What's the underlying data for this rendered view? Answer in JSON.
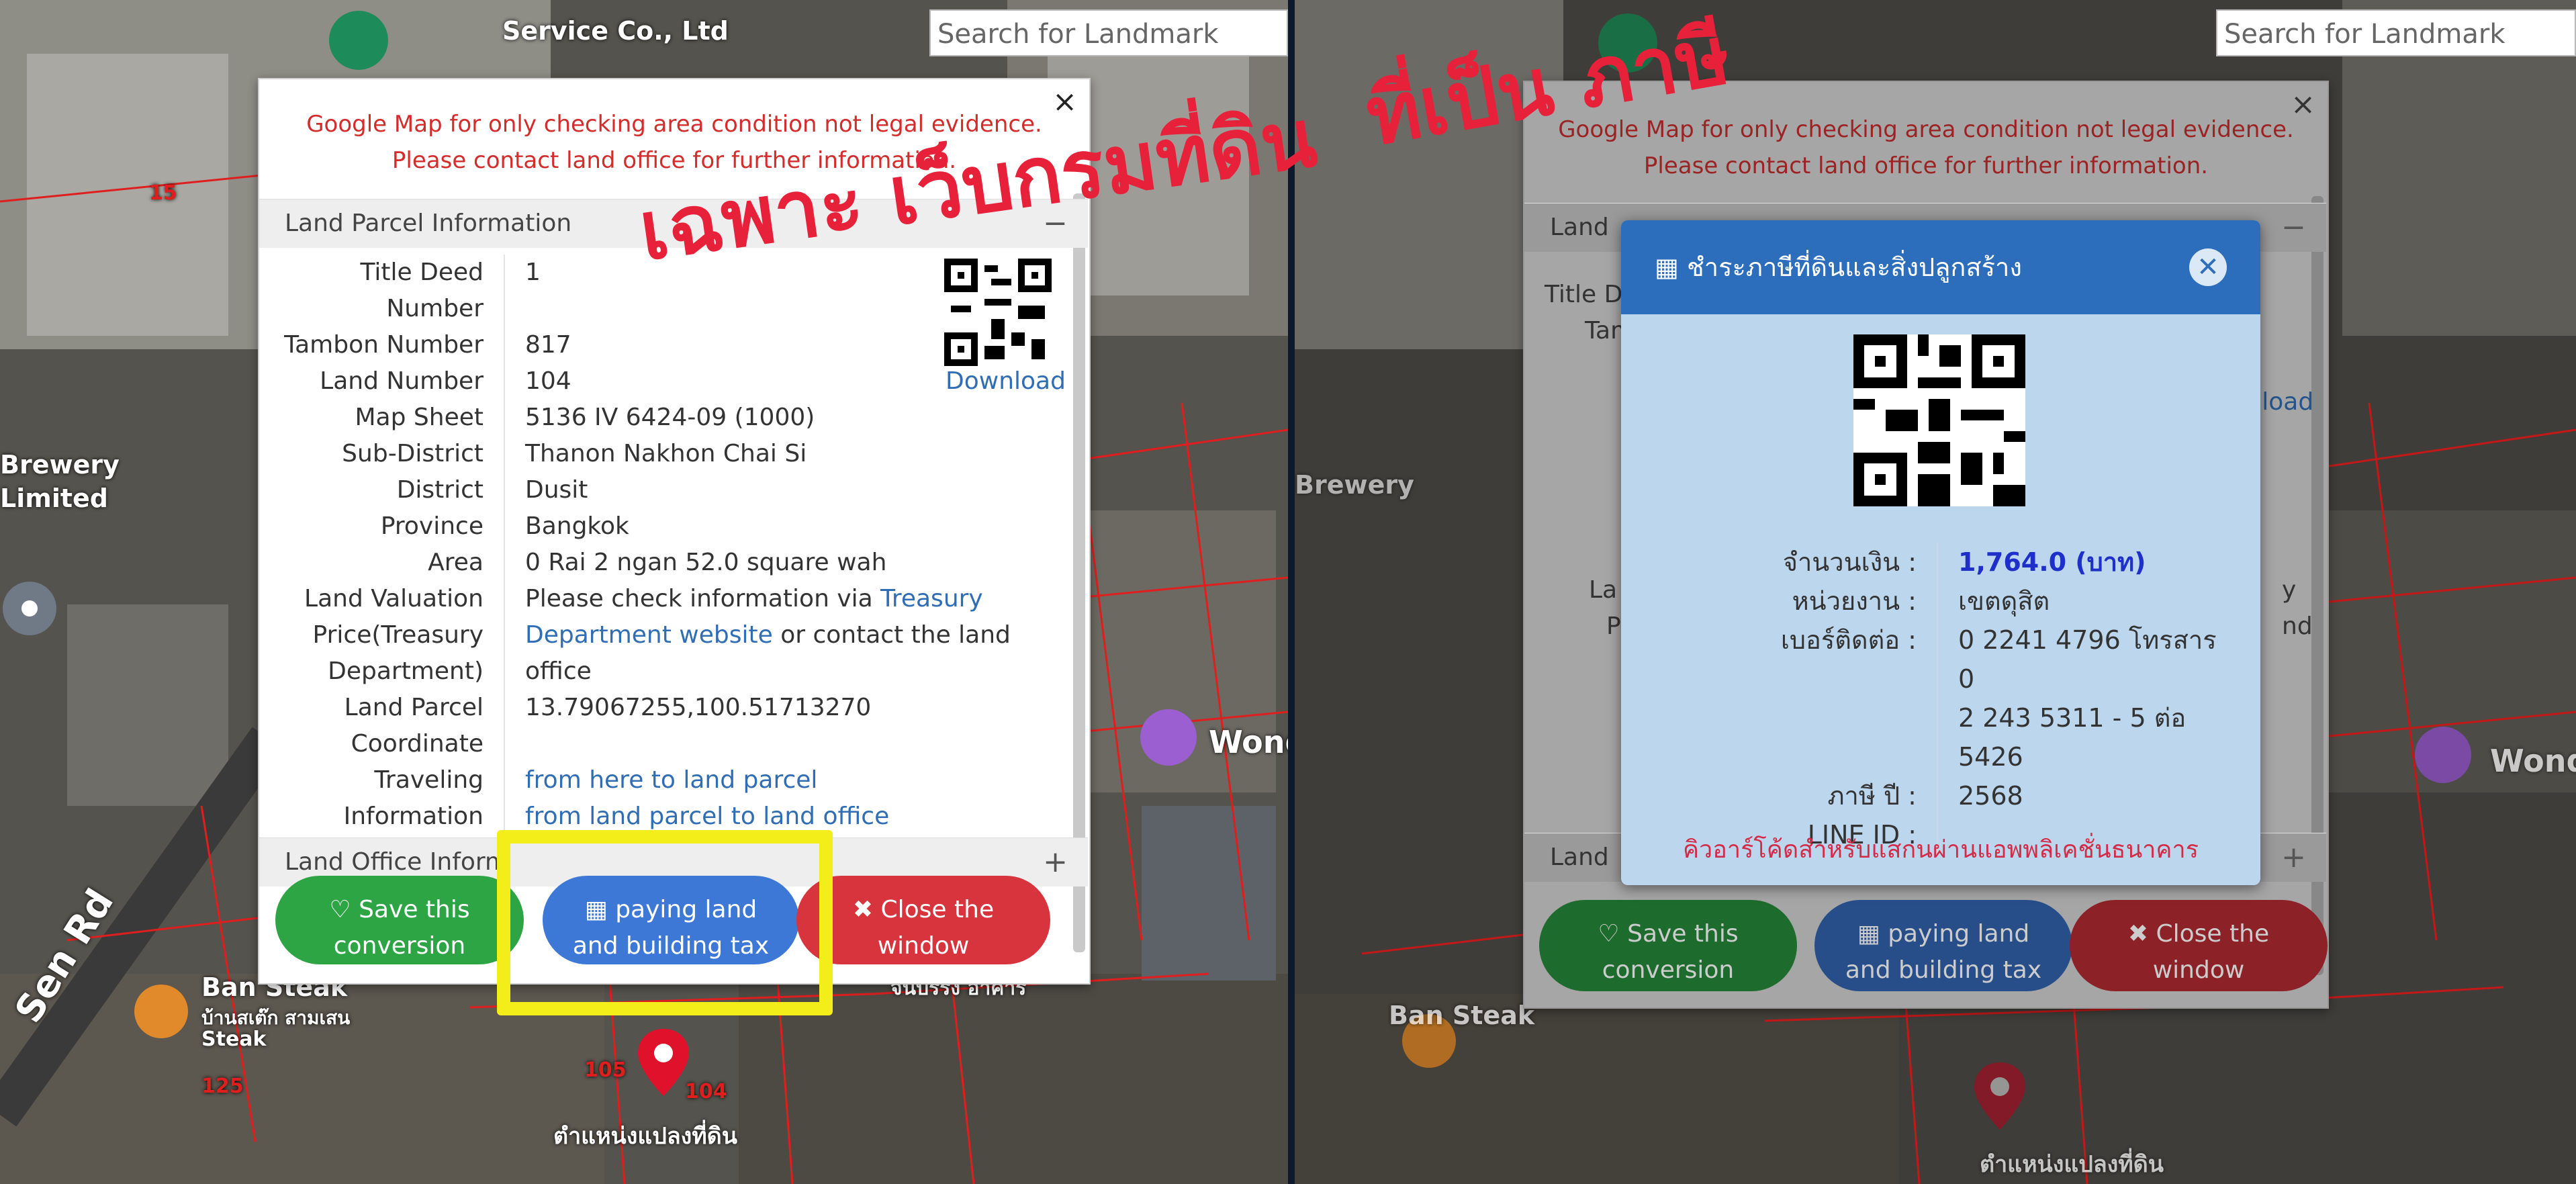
{
  "search": {
    "placeholder": "Search for Landmark"
  },
  "annotation": {
    "line1": "เฉพาะ เว็บกรมที่ดิน",
    "line2": "ที่เป็น ภาษี"
  },
  "map": {
    "labels": {
      "service": "Service Co., Ltd",
      "brewery": "Brewery",
      "limited": "Limited",
      "ban_steak": "Ban Steak",
      "ban_steak_thai": "บ้านสเต๊ก สามเสน",
      "steak": "Steak",
      "road": "Sen Rd",
      "wonder": "Wond",
      "parcel_pos": "ตำแหน่งแปลงที่ดิน",
      "shop": "จันบรรง อาคาร"
    },
    "numbers": [
      "15",
      "125",
      "104",
      "105"
    ]
  },
  "left_popup": {
    "close": "×",
    "notice_line1": "Google Map for only checking area condition not legal evidence.",
    "notice_line2": "Please contact land office for further information.",
    "parcel_section": "Land Parcel Information",
    "parcel_sign": "−",
    "rows": {
      "title_deed": {
        "label": "Title Deed Number",
        "value": "1"
      },
      "tambon": {
        "label": "Tambon Number",
        "value": "817"
      },
      "land_number": {
        "label": "Land Number",
        "value": "104"
      },
      "map_sheet": {
        "label": "Map Sheet",
        "value": "5136 IV 6424-09 (1000)"
      },
      "sub_district": {
        "label": "Sub-District",
        "value": "Thanon Nakhon Chai Si"
      },
      "district": {
        "label": "District",
        "value": "Dusit"
      },
      "province": {
        "label": "Province",
        "value": "Bangkok"
      },
      "area": {
        "label": "Area",
        "value": "0 Rai 2 ngan 52.0 square wah"
      },
      "valuation_l1": "Land Valuation",
      "valuation_l2": "Price(Treasury",
      "valuation_l3": "Department)",
      "valuation_v1a": "Please check information via ",
      "valuation_v1b": "Treasury",
      "valuation_v2a": "Department website",
      "valuation_v2b": " or contact the land",
      "valuation_v3": "office",
      "coord_l1": "Land Parcel",
      "coord_l2": "Coordinate",
      "coord_value": "13.79067255,100.51713270",
      "travel_l1": "Traveling",
      "travel_l2": "Information",
      "travel_v1": "from here to land parcel",
      "travel_v2": "from land parcel to land office"
    },
    "download": "Download",
    "office_section": "Land Office Inform",
    "office_sign": "+",
    "buttons": {
      "save_l1": "♡ Save this",
      "save_l2": "conversion",
      "tax_l1": "▦ paying land",
      "tax_l2": "and building tax",
      "close_l1": "✖ Close the",
      "close_l2": "window"
    }
  },
  "right_popup": {
    "notice_line1": "Google Map for only checking area condition not legal evidence.",
    "notice_line2": "Please contact land office for further information.",
    "close": "×",
    "land_stub": "Land",
    "title_stub": "Title D",
    "tam_stub": "Tam",
    "l_stub": "L",
    "la_stub": "La",
    "p_stub": "P",
    "nd_stub": "nd",
    "y_stub": "y",
    "download_stub": "wnload",
    "land_bottom": "Land",
    "sign_minus": "−",
    "sign_plus": "+",
    "buttons": {
      "save_l1": "♡ Save this",
      "save_l2": "conversion",
      "tax_l1": "▦ paying land",
      "tax_l2": "and building tax",
      "close_l1": "✖ Close the",
      "close_l2": "window"
    }
  },
  "modal": {
    "title": "▦ ชำระภาษีที่ดินและสิ่งปลูกสร้าง",
    "close": "✕",
    "amount_label": "จำนวนเงิน :",
    "amount_value": "1,764.0 (บาท)",
    "agency_label": "หน่วยงาน :",
    "agency_value": "เขตดุสิต",
    "phone_label": "เบอร์ติดต่อ :",
    "phone_l1": "0 2241 4796 โทรสาร 0",
    "phone_l2": "2 243 5311 - 5 ต่อ",
    "phone_l3": "5426",
    "year_label": "ภาษี ปี :",
    "year_value": "2568",
    "line_label": "LINE ID :",
    "line_value": "",
    "qr_note": "คิวอาร์โค้ดสำหรับแสกนผ่านแอพพลิเคชั่นธนาคาร",
    "amount_color": "#1f2fc9"
  }
}
